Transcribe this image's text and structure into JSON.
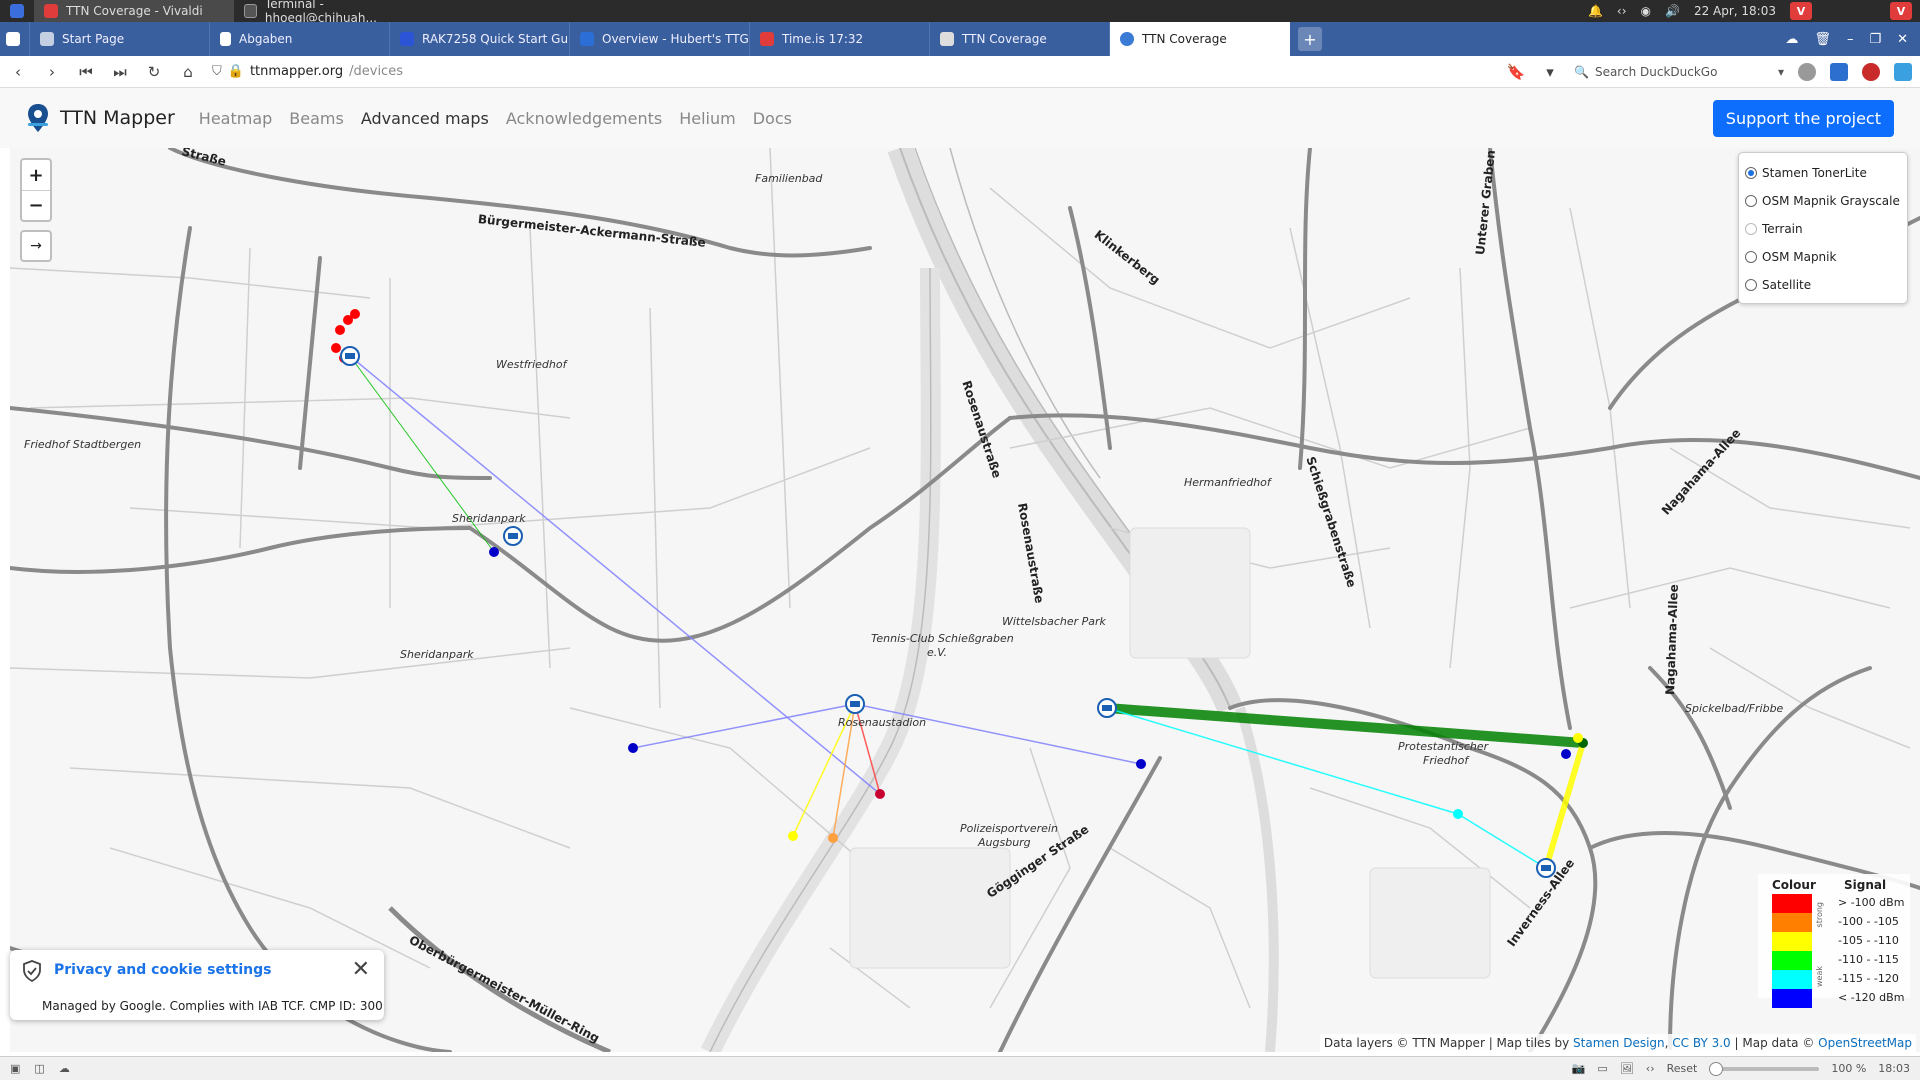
{
  "os": {
    "windows": [
      {
        "title": "TTN Coverage - Vivaldi",
        "active": true,
        "color": "#e03c3c"
      },
      {
        "title": "Terminal - hhoegl@chihuah...",
        "active": false,
        "color": "#444"
      }
    ],
    "clock": "22 Apr, 18:03"
  },
  "tabs": [
    {
      "title": "Start Page",
      "color": "#3a6edc"
    },
    {
      "title": "Abgaben",
      "color": "#ffffff"
    },
    {
      "title": "RAK7258 Quick Start Guid",
      "color": "#2b54d6"
    },
    {
      "title": "Overview - Hubert's TTGO",
      "color": "#2b6fd6"
    },
    {
      "title": "Time.is 17:32",
      "color": "#e03c3c"
    },
    {
      "title": "TTN Coverage",
      "color": "#dddddd"
    },
    {
      "title": "TTN Coverage",
      "color": "#3a7bd5"
    }
  ],
  "address": {
    "host": "ttnmapper.org",
    "path": "/devices",
    "search_placeholder": "Search DuckDuckGo"
  },
  "site": {
    "brand": "TTN Mapper",
    "nav": [
      "Heatmap",
      "Beams",
      "Advanced maps",
      "Acknowledgements",
      "Helium",
      "Docs"
    ],
    "active_nav": "Advanced maps",
    "support": "Support the project"
  },
  "map": {
    "zoom_in": "+",
    "zoom_out": "−",
    "expand": "→",
    "layers": [
      {
        "label": "Stamen TonerLite",
        "selected": true
      },
      {
        "label": "OSM Mapnik Grayscale",
        "selected": false
      },
      {
        "label": "Terrain",
        "selected": false
      },
      {
        "label": "OSM Mapnik",
        "selected": false
      },
      {
        "label": "Satellite",
        "selected": false
      }
    ],
    "place_labels": [
      "Familienbad",
      "Westfriedhof",
      "Friedhof Stadtbergen",
      "Sheridanpark",
      "Sheridanpark",
      "Hermanfriedhof",
      "Wittelsbacher Park",
      "Tennis-Club Schießgraben",
      "e.V.",
      "Rosenaustadion",
      "Protestantischer",
      "Friedhof",
      "Spickelbad/Fribbe",
      "Polizeisportverein",
      "Augsburg"
    ],
    "street_labels": [
      "Straße",
      "Bürgermeister-Ackermann-Straße",
      "Klinkerberg",
      "Unterer Graben",
      "Rosenaustraße",
      "Rosenaustraße",
      "Schießgrabenstraße",
      "Nagahama-Allee",
      "Nagahama-Allee",
      "Gögginger Straße",
      "Inverness-Allee",
      "Oberbürgermeister-Müller-Ring"
    ],
    "legend": {
      "colour_header": "Colour",
      "signal_header": "Signal",
      "strong": "strong",
      "weak": "weak",
      "items": [
        {
          "color": "#ff0000",
          "label": "> -100 dBm"
        },
        {
          "color": "#ff7f00",
          "label": "-100 - -105"
        },
        {
          "color": "#ffff00",
          "label": "-105 - -110"
        },
        {
          "color": "#00ff00",
          "label": "-110 - -115"
        },
        {
          "color": "#00ffff",
          "label": "-115 - -120"
        },
        {
          "color": "#0000ff",
          "label": "< -120 dBm"
        }
      ]
    },
    "attribution": {
      "prefix": "Data layers © TTN Mapper | Map tiles by ",
      "link1": "Stamen Design",
      "mid": ", ",
      "link2": "CC BY 3.0",
      "mid2": " | Map data © ",
      "link3": "OpenStreetMap"
    }
  },
  "privacy": {
    "title": "Privacy and cookie settings",
    "subtitle": "Managed by Google. Complies with IAB TCF. CMP ID: 300"
  },
  "status": {
    "reset": "Reset",
    "zoom": "100 %",
    "clock": "18:03"
  }
}
